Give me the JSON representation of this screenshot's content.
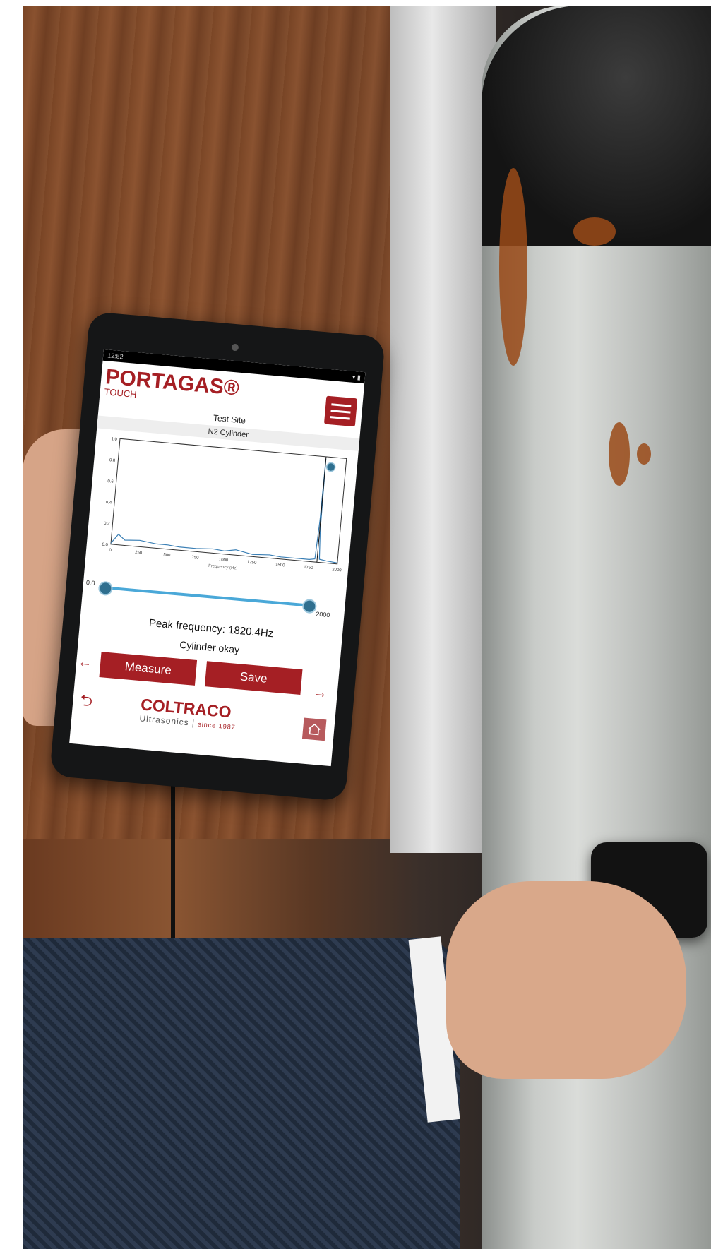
{
  "tablet": {
    "status_time": "12:52",
    "app_logo": "PORTAGAS®",
    "app_logo_sub": "TOUCH",
    "site_name": "Test Site",
    "cylinder_name": "N2 Cylinder",
    "slider_min": "0.0",
    "slider_max": "2000",
    "peak_frequency": "Peak frequency: 1820.4Hz",
    "status": "Cylinder okay",
    "measure_label": "Measure",
    "save_label": "Save",
    "brand": "COLTRACO",
    "brand_sub": "Ultrasonics",
    "brand_since": "since 1987"
  },
  "chart_data": {
    "type": "line",
    "x": [
      0,
      60,
      120,
      250,
      400,
      500,
      600,
      750,
      900,
      1000,
      1100,
      1250,
      1400,
      1500,
      1650,
      1750,
      1800,
      1815,
      1820,
      1825,
      1840,
      1900,
      2000
    ],
    "y": [
      0.01,
      0.1,
      0.05,
      0.06,
      0.04,
      0.04,
      0.03,
      0.03,
      0.04,
      0.03,
      0.05,
      0.02,
      0.03,
      0.02,
      0.02,
      0.02,
      0.03,
      0.4,
      0.98,
      0.3,
      0.03,
      0.02,
      0.01
    ],
    "ylim": [
      0,
      1.0
    ],
    "xlim": [
      0,
      2000
    ],
    "yticks": [
      "0.0",
      "0.2",
      "0.4",
      "0.6",
      "0.8",
      "1.0"
    ],
    "xticks": [
      "0",
      "250",
      "500",
      "750",
      "1000",
      "1250",
      "1500",
      "1750",
      "2000"
    ],
    "xlabel": "Frequency (Hz)",
    "ylabel": "",
    "series_color": "#3a7fb5"
  }
}
